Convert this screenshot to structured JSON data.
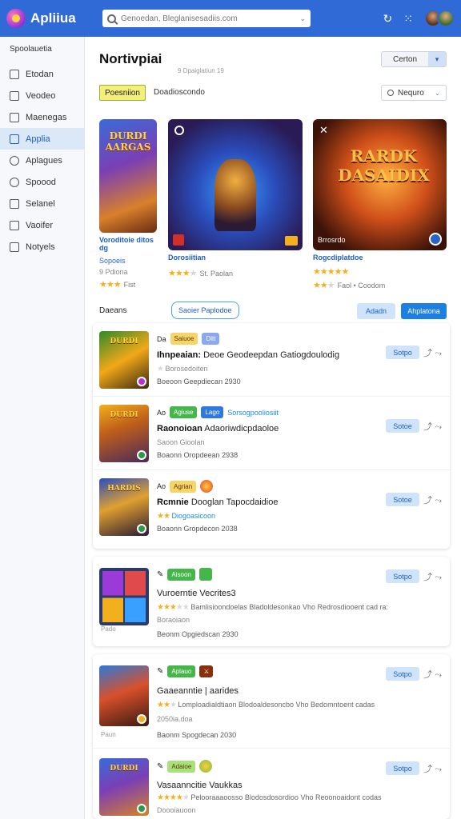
{
  "app": {
    "name": "Apliiua"
  },
  "search": {
    "placeholder": "Genoedan, Bleglanisesadiis.com"
  },
  "sidebar": {
    "heading": "Spoolauetia",
    "items": [
      {
        "label": "Etodan",
        "icon": "home-icon"
      },
      {
        "label": "Veodeo",
        "icon": "video-icon"
      },
      {
        "label": "Maenegas",
        "icon": "calendar-icon"
      },
      {
        "label": "Applia",
        "icon": "apps-icon",
        "active": true
      },
      {
        "label": "Aplagues",
        "icon": "globe-icon"
      },
      {
        "label": "Spoood",
        "icon": "circle-icon"
      },
      {
        "label": "Selanel",
        "icon": "settings-icon"
      },
      {
        "label": "Vaoifer",
        "icon": "image-icon"
      },
      {
        "label": "Notyels",
        "icon": "list-icon"
      }
    ]
  },
  "main": {
    "title": "Nortivpiai",
    "subtitle": "9 Dpaiglatiun 19",
    "sort_label": "Certon",
    "chip_label": "Poesniion",
    "chip_text": "Doadioscondo",
    "filter_label": "Nequro"
  },
  "featured": [
    {
      "art_title": "DURDI AARGAS",
      "caption": "Voroditoie ditos dg",
      "sub": "Sopoeis",
      "meta": "9 Pdiona",
      "rating": 3,
      "rate_text": "Fist"
    },
    {
      "art_title": "",
      "caption": "Dorosiitian",
      "sub": "",
      "meta": "",
      "rating": 3,
      "rate_text": "St. Paolan"
    },
    {
      "art_title": "RARDK DASAIDIX",
      "caption": "Rogcdiplatdoe",
      "sub": "",
      "meta": "Brrosrdo",
      "rating": 5,
      "rate_text": "Faol • Coodom"
    }
  ],
  "section": {
    "label": "Daeans",
    "pill": "Saoier Paplodoe",
    "btn1": "Adadn",
    "btn2": "Ahplatona"
  },
  "list1": [
    {
      "tags": [
        "Da",
        "Saiuoe",
        "Ditt"
      ],
      "title_bold": "Ihnpeaian:",
      "title_rest": "Deoe Geodeepdan Gatiogdoulodig",
      "sub": "Borosedoiten",
      "foot": "Boeoon Geepdiecan 2930",
      "action": "Sotpo"
    },
    {
      "tags": [
        "Ao",
        "Agiuse",
        "Lago",
        "Sorsogpooliosiit"
      ],
      "title_bold": "Raonoioan",
      "title_rest": "Adaoriwdicpdaoloe",
      "sub": "Saoon Gioolan",
      "foot": "Boaonn Oropdeean 2938",
      "action": "Sotoe"
    },
    {
      "tags": [
        "Ao",
        "Agrian"
      ],
      "title_bold": "Rcmnie",
      "title_rest": "Dooglan Tapocdaidioe",
      "sub": "Diogoasicoon",
      "foot": "Boaonn Gropdecon 2038",
      "action": "Sotoe"
    }
  ],
  "list2": [
    {
      "tags": [
        "Aisoon"
      ],
      "title": "Vuroerntie Vecrites3",
      "desc": "Bamlisioondoelas Bladoldesonkao Vho Redrosdiooent cad ra:",
      "sub": "Boraoiaon",
      "foot": "Beonm Opgiedscan 2930",
      "note": "Pado",
      "action": "Sotpo",
      "rating": 3
    }
  ],
  "list3": [
    {
      "tags": [
        "Aplauo"
      ],
      "title": "Gaaeanntie | aarides",
      "desc": "Lomploadialdtiaon Blodoaldesoncbo Vho Bedomntoent cadas",
      "sub": "2050ia.doa",
      "foot": "Baonm Spogdecan 2030",
      "note": "Paun",
      "action": "Sotpo",
      "rating": 2
    },
    {
      "tags": [
        "Adaioe"
      ],
      "title": "Vasaanncitie Vaukkas",
      "desc": "Pelooraaaoosso Blodosdosordioo Vho Reoonoaidont codas",
      "sub": "Doooiauoon",
      "foot": "",
      "note": "",
      "action": "Sotpo",
      "rating": 4
    }
  ],
  "colors": {
    "accent": "#2f6ad6",
    "button_light": "#cfe3fa",
    "button_dark": "#1e7fe3",
    "star": "#f2b01e"
  }
}
